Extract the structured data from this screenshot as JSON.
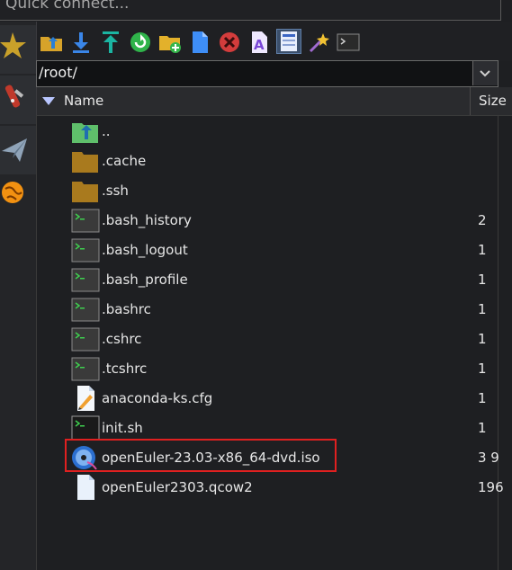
{
  "quick_connect": {
    "placeholder": "Quick connect..."
  },
  "path": {
    "value": "/root/"
  },
  "header": {
    "name_label": "Name",
    "size_label": "Size"
  },
  "files": [
    {
      "name": "..",
      "size": "",
      "icon": "parent-folder-icon"
    },
    {
      "name": ".cache",
      "size": "",
      "icon": "folder-icon"
    },
    {
      "name": ".ssh",
      "size": "",
      "icon": "folder-icon"
    },
    {
      "name": ".bash_history",
      "size": "2",
      "icon": "terminal-file-icon"
    },
    {
      "name": ".bash_logout",
      "size": "1",
      "icon": "terminal-file-icon"
    },
    {
      "name": ".bash_profile",
      "size": "1",
      "icon": "terminal-file-icon"
    },
    {
      "name": ".bashrc",
      "size": "1",
      "icon": "terminal-file-icon"
    },
    {
      "name": ".cshrc",
      "size": "1",
      "icon": "terminal-file-icon"
    },
    {
      "name": ".tcshrc",
      "size": "1",
      "icon": "terminal-file-icon"
    },
    {
      "name": "anaconda-ks.cfg",
      "size": "1",
      "icon": "text-file-edit-icon"
    },
    {
      "name": "init.sh",
      "size": "1",
      "icon": "script-file-icon"
    },
    {
      "name": "openEuler-23.03-x86_64-dvd.iso",
      "size": "3 9",
      "icon": "disc-image-icon"
    },
    {
      "name": "openEuler2303.qcow2",
      "size": "196",
      "icon": "blank-file-icon"
    }
  ],
  "colors": {
    "highlight": "#e02020",
    "folder": "#a97a1e",
    "accent": "#3f8cff"
  }
}
